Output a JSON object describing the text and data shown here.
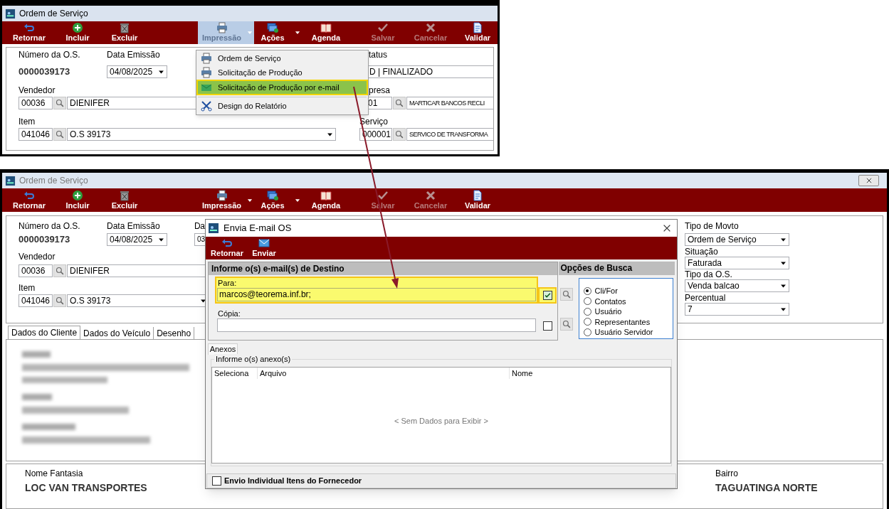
{
  "top_window": {
    "title": "Ordem de Serviço",
    "toolbar": [
      {
        "kind": "back",
        "label": "Retornar",
        "disabled": false,
        "pressed": false
      },
      {
        "kind": "add",
        "label": "Incluir",
        "disabled": false,
        "pressed": false
      },
      {
        "kind": "delete",
        "label": "Excluir",
        "disabled": false,
        "pressed": false
      },
      {
        "kind": "print",
        "label": "Impressão",
        "disabled": false,
        "pressed": true
      },
      {
        "kind": "dropdown",
        "pressed": true
      },
      {
        "kind": "actions",
        "label": "Ações",
        "disabled": false,
        "pressed": false
      },
      {
        "kind": "dropdown",
        "pressed": false
      },
      {
        "kind": "book",
        "label": "Agenda",
        "disabled": false,
        "pressed": false
      },
      {
        "kind": "check",
        "label": "Salvar",
        "disabled": true,
        "pressed": false
      },
      {
        "kind": "cancel",
        "label": "Cancelar",
        "disabled": true,
        "pressed": false
      },
      {
        "kind": "validate",
        "label": "Validar",
        "disabled": false,
        "pressed": false
      }
    ],
    "os_number": {
      "label": "Número da O.S.",
      "value": "0000039173"
    },
    "data_emissao": {
      "label": "Data Emissão",
      "value": "04/08/2025"
    },
    "vendedor": {
      "label": "Vendedor",
      "code": "00036",
      "name": "DIENIFER"
    },
    "item": {
      "label": "Item",
      "code": "041046",
      "name": "O.S 39173"
    },
    "status": {
      "label": "tatus",
      "value": "D | FINALIZADO"
    },
    "empresa": {
      "label": "presa",
      "code": "01",
      "name": "MARTICAR BANCOS RECLI"
    },
    "servico": {
      "label": "Serviço",
      "code": "000001",
      "name": "SERVICO DE TRANSFORMA"
    },
    "print_menu": [
      {
        "kind": "print",
        "label": "Ordem de Serviço",
        "selected": false,
        "separator_before": false
      },
      {
        "kind": "print",
        "label": "Solicitação de Produção",
        "selected": false,
        "separator_before": false
      },
      {
        "kind": "email",
        "label": "Solicitação de Produção por e-mail",
        "selected": true,
        "separator_before": false
      },
      {
        "kind": "tools",
        "label": "Design do Relatório",
        "selected": false,
        "separator_before": true
      }
    ]
  },
  "bottom_window": {
    "title": "Ordem de Serviço",
    "toolbar": [
      {
        "kind": "back",
        "label": "Retornar",
        "disabled": false,
        "pressed": false
      },
      {
        "kind": "add",
        "label": "Incluir",
        "disabled": false,
        "pressed": false
      },
      {
        "kind": "delete",
        "label": "Excluir",
        "disabled": false,
        "pressed": false
      },
      {
        "kind": "print",
        "label": "Impressão",
        "disabled": false,
        "pressed": false
      },
      {
        "kind": "dropdown",
        "pressed": false
      },
      {
        "kind": "actions",
        "label": "Ações",
        "disabled": false,
        "pressed": false
      },
      {
        "kind": "dropdown",
        "pressed": false
      },
      {
        "kind": "book",
        "label": "Agenda",
        "disabled": false,
        "pressed": false
      },
      {
        "kind": "check",
        "label": "Salvar",
        "disabled": true,
        "pressed": false
      },
      {
        "kind": "cancel",
        "label": "Cancelar",
        "disabled": true,
        "pressed": false
      },
      {
        "kind": "validate",
        "label": "Validar",
        "disabled": false,
        "pressed": false
      }
    ],
    "os_number": {
      "label": "Número da O.S.",
      "value": "0000039173"
    },
    "data_emissao": {
      "label": "Data Emissão",
      "value": "04/08/2025"
    },
    "data_2": {
      "label": "Da",
      "value": "03"
    },
    "vendedor": {
      "label": "Vendedor",
      "code": "00036",
      "name": "DIENIFER"
    },
    "item": {
      "label": "Item",
      "code": "041046",
      "name": "O.S 39173"
    },
    "tipo_movto": {
      "label": "Tipo de Movto",
      "value": "Ordem de Serviço"
    },
    "situacao": {
      "label": "Situação",
      "value": "Faturada"
    },
    "tipo_os": {
      "label": "Tipo da O.S.",
      "value": "Venda balcao"
    },
    "percentual": {
      "label": "Percentual",
      "value": "7"
    },
    "tabs": [
      {
        "label": "Dados do Cliente",
        "selected": true
      },
      {
        "label": "Dados do Veículo",
        "selected": false
      },
      {
        "label": "Desenho",
        "selected": false
      }
    ],
    "nome_fantasia": {
      "label": "Nome Fantasia",
      "value": "LOC VAN TRANSPORTES"
    },
    "bairro": {
      "label": "Bairro",
      "value": "TAGUATINGA NORTE"
    }
  },
  "dialog": {
    "title": "Envia E-mail OS",
    "toolbar": [
      {
        "kind": "back",
        "label": "Retornar",
        "disabled": false,
        "pressed": false
      },
      {
        "kind": "mail",
        "label": "Enviar",
        "disabled": false,
        "pressed": false
      }
    ],
    "destino": {
      "title": "Informe o(s) e-mail(s) de Destino",
      "para": {
        "label": "Para:",
        "value": "marcos@teorema.inf.br;",
        "checked": true,
        "highlighted": true
      },
      "copia": {
        "label": "Cópia:",
        "checked": false,
        "highlighted": false
      }
    },
    "busca": {
      "title": "Opções de Busca",
      "options": [
        {
          "label": "Cli/For",
          "selected": true
        },
        {
          "label": "Contatos",
          "selected": false
        },
        {
          "label": "Usuário",
          "selected": false
        },
        {
          "label": "Representantes",
          "selected": false
        },
        {
          "label": "Usuário Servidor",
          "selected": false
        }
      ]
    },
    "anexos_tab": "Anexos",
    "anexos_group": "Informe o(s) anexo(s)",
    "columns": [
      "Seleciona",
      "Arquivo",
      "Nome"
    ],
    "empty_text": "< Sem Dados para Exibir >",
    "individual": {
      "label": "Envio Individual Itens do Fornecedor",
      "checked": false
    }
  }
}
